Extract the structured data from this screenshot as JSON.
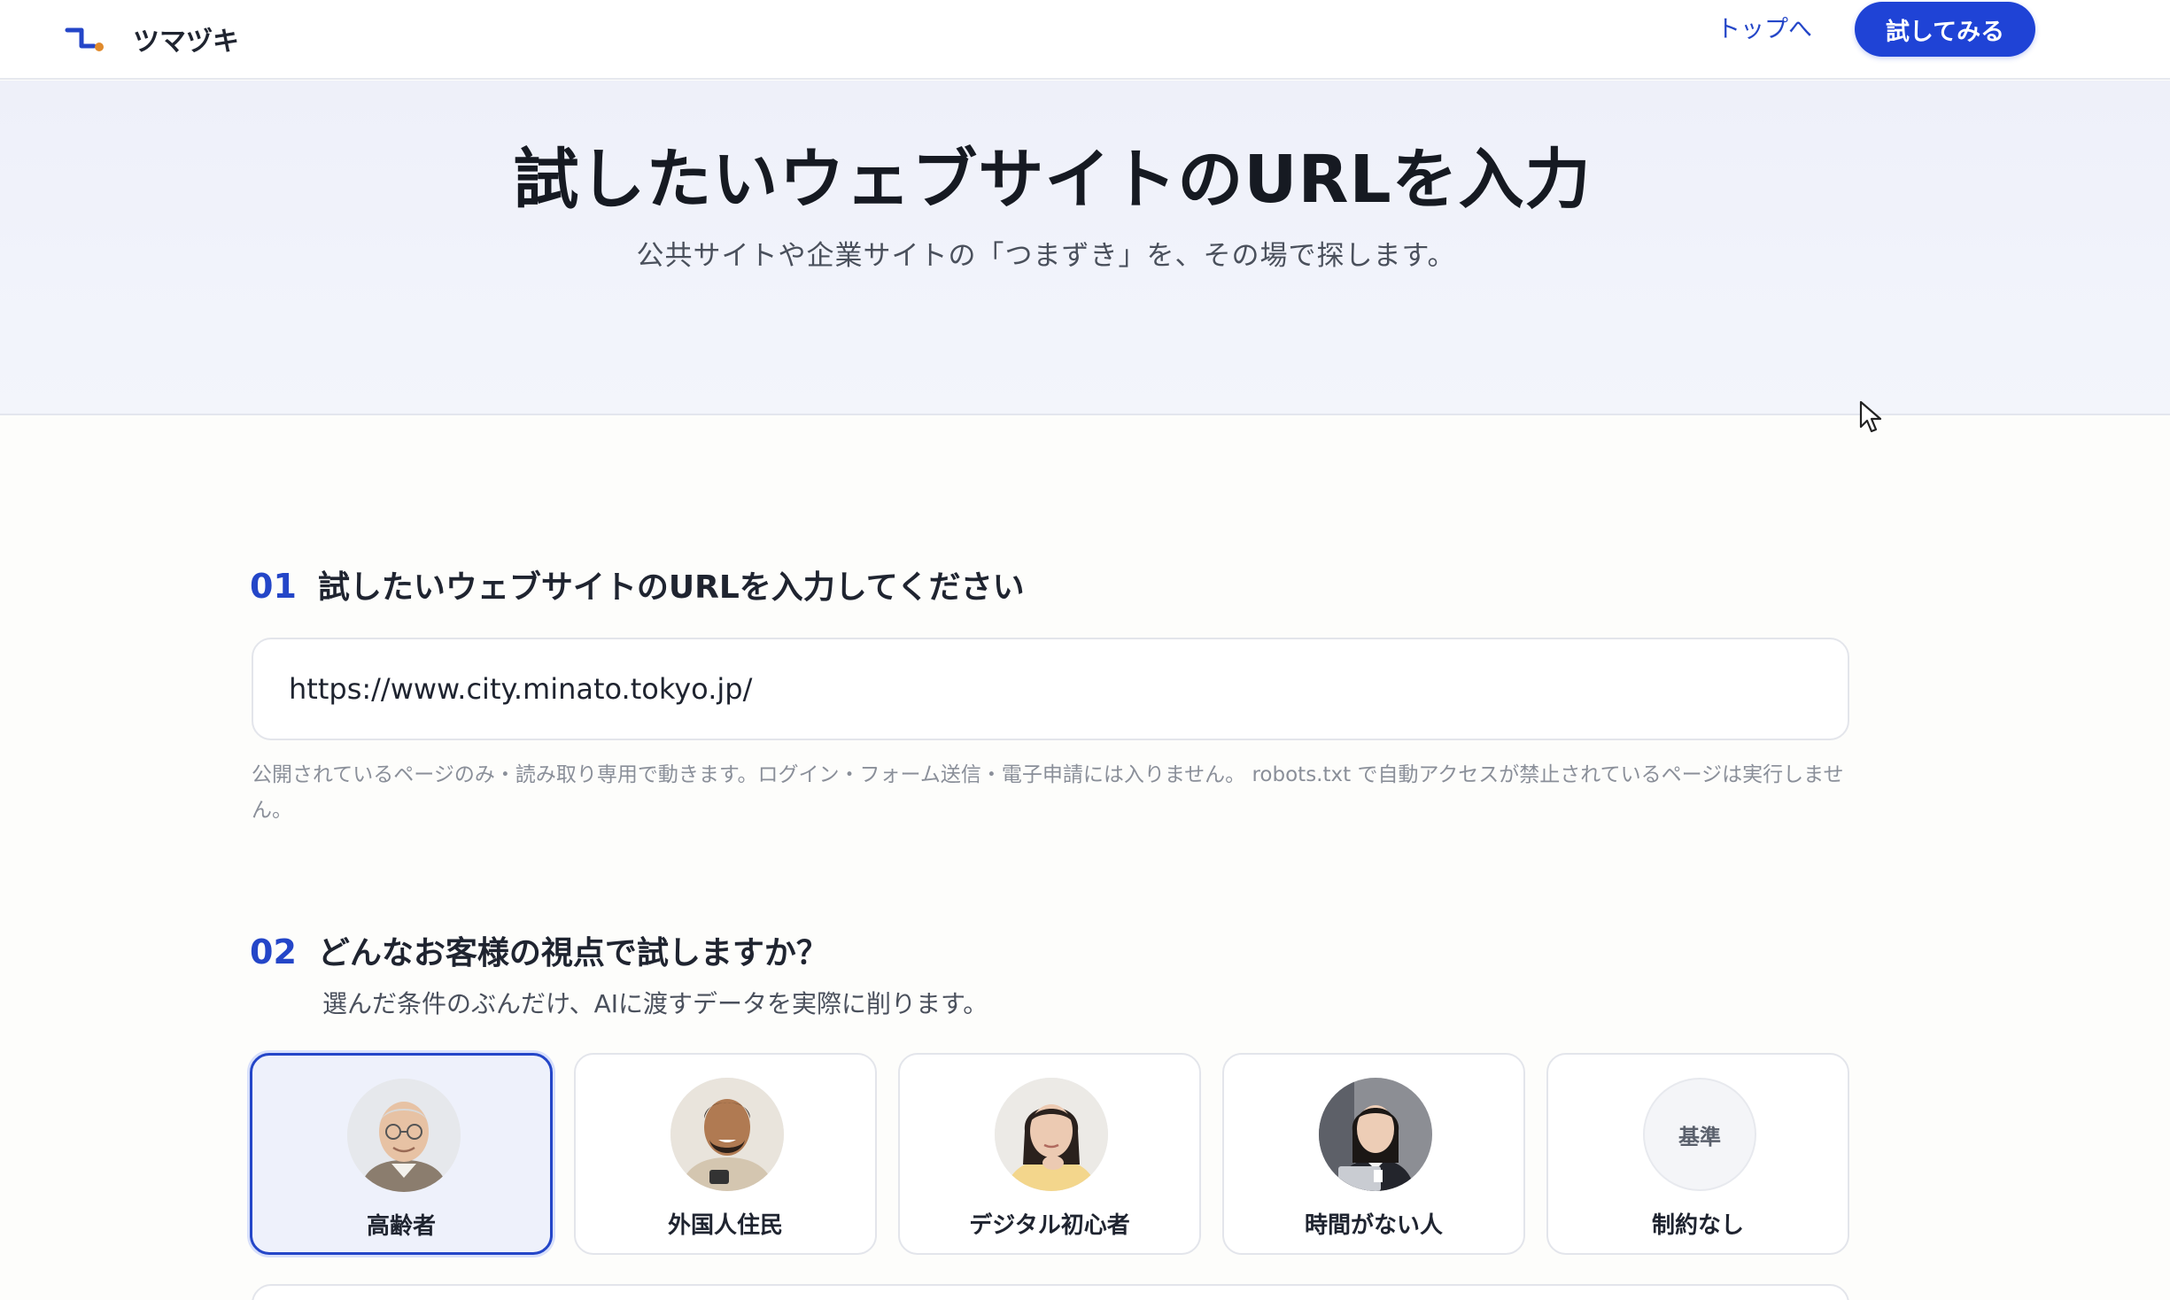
{
  "header": {
    "logo_text": "ツマヅキ",
    "nav_top_label": "トップへ",
    "cta_label": "試してみる"
  },
  "hero": {
    "title": "試したいウェブサイトのURLを入力",
    "subtitle": "公共サイトや企業サイトの「つまずき」を、その場で探します。"
  },
  "step1": {
    "number": "01",
    "title": "試したいウェブサイトのURLを入力してください",
    "url_value": "https://www.city.minato.tokyo.jp/",
    "note": "公開されているページのみ・読み取り専用で動きます。ログイン・フォーム送信・電子申請には入りません。 robots.txt で自動アクセスが禁止されているページは実行しません。"
  },
  "step2": {
    "number": "02",
    "title": "どんなお客様の視点で試しますか？",
    "description": "選んだ条件のぶんだけ、AIに渡すデータを実際に削ります。",
    "personas": [
      {
        "label": "高齢者",
        "icon": "elderly-man-avatar",
        "selected": true
      },
      {
        "label": "外国人住民",
        "icon": "foreign-resident-avatar",
        "selected": false
      },
      {
        "label": "デジタル初心者",
        "icon": "digital-beginner-avatar",
        "selected": false
      },
      {
        "label": "時間がない人",
        "icon": "busy-person-avatar",
        "selected": false
      },
      {
        "label": "制約なし",
        "avatar_text": "基準",
        "selected": false
      }
    ]
  },
  "colors": {
    "accent": "#1f43d6",
    "link": "#2446c8",
    "logo_dot": "#e08a2c"
  }
}
